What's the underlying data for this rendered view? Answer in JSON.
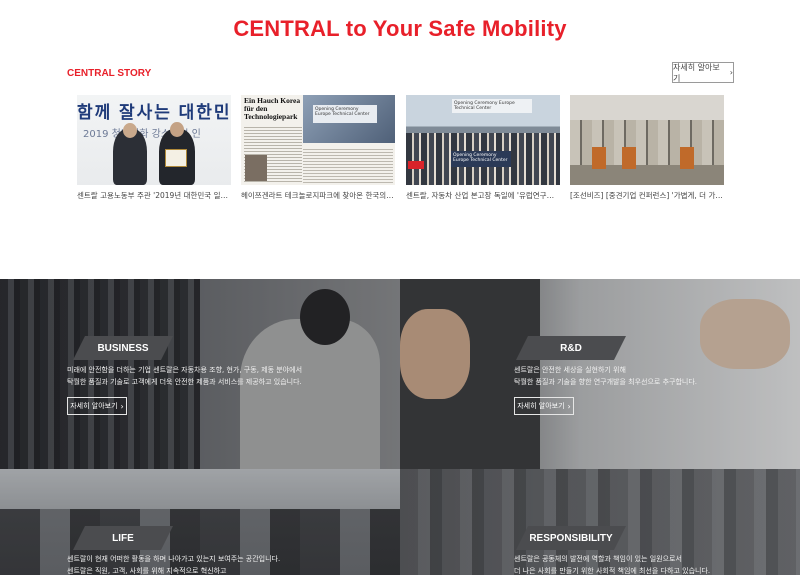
{
  "hero": {
    "title": "CENTRAL to Your Safe Mobility"
  },
  "story": {
    "heading": "CENTRAL STORY",
    "more_label": "자세히 알아보기",
    "cards": [
      {
        "caption": "센트랄 고용노동부 주관 '2019년 대한민국 일자…",
        "banner": "함께 잘사는 대한민",
        "banner_sub": "2019 청년친화 강소기업 인"
      },
      {
        "caption": "헤이쯔겐라트 테크놀로지파크에 찾아온 한국의 …",
        "headline": "Ein Hauch Korea für den Technologiepark",
        "sign": "Opening Ceremony Europe Technical Center"
      },
      {
        "caption": "센트랄, 자동차 산업 본고장 독일에 '유럽연구센…",
        "sign_top": "Opening Ceremony Europe Technical Center",
        "sign_bottom": "Opening Ceremony Europe Technical Center"
      },
      {
        "caption": "[조선비즈] [중견기업 컨퍼런스] '가볍게, 더 가…"
      }
    ]
  },
  "sections": {
    "business": {
      "title": "BUSINESS",
      "line1": "미래에 안전함을 더하는 기업 센트랄은 자동차용 조향, 현가, 구동, 제동 분야에서",
      "line2": "탁월한 품질과 기술로 고객에게 더욱 안전한 제품과 서비스를 제공하고 있습니다.",
      "more_label": "자세히 알아보기"
    },
    "rnd": {
      "title": "R&D",
      "line1": "센트랄은 안전한 세상을 실현하기 위해",
      "line2": "탁월한 품질과 기술을 향한 연구개발을 최우선으로 추구합니다.",
      "more_label": "자세히 알아보기"
    },
    "life": {
      "title": "LIFE",
      "line1": "센트랄이 현재 어떠한 활동을 하며 나아가고 있는지 보여주는 공간입니다.",
      "line2": "센트랄은 직원, 고객, 사회를 위해 지속적으로 혁신하고"
    },
    "responsibility": {
      "title": "RESPONSIBILITY",
      "line1": "센트랄은 공동체의 발전에 역할과 책임이 있는 일원으로서",
      "line2": "더 나은 사회를 만들기 위한 사회적 책임에 최선을 다하고 있습니다."
    }
  },
  "icons": {
    "more": "chevron-right-icon"
  },
  "colors": {
    "accent": "#e8202a",
    "pill": "#4b4c4f"
  }
}
